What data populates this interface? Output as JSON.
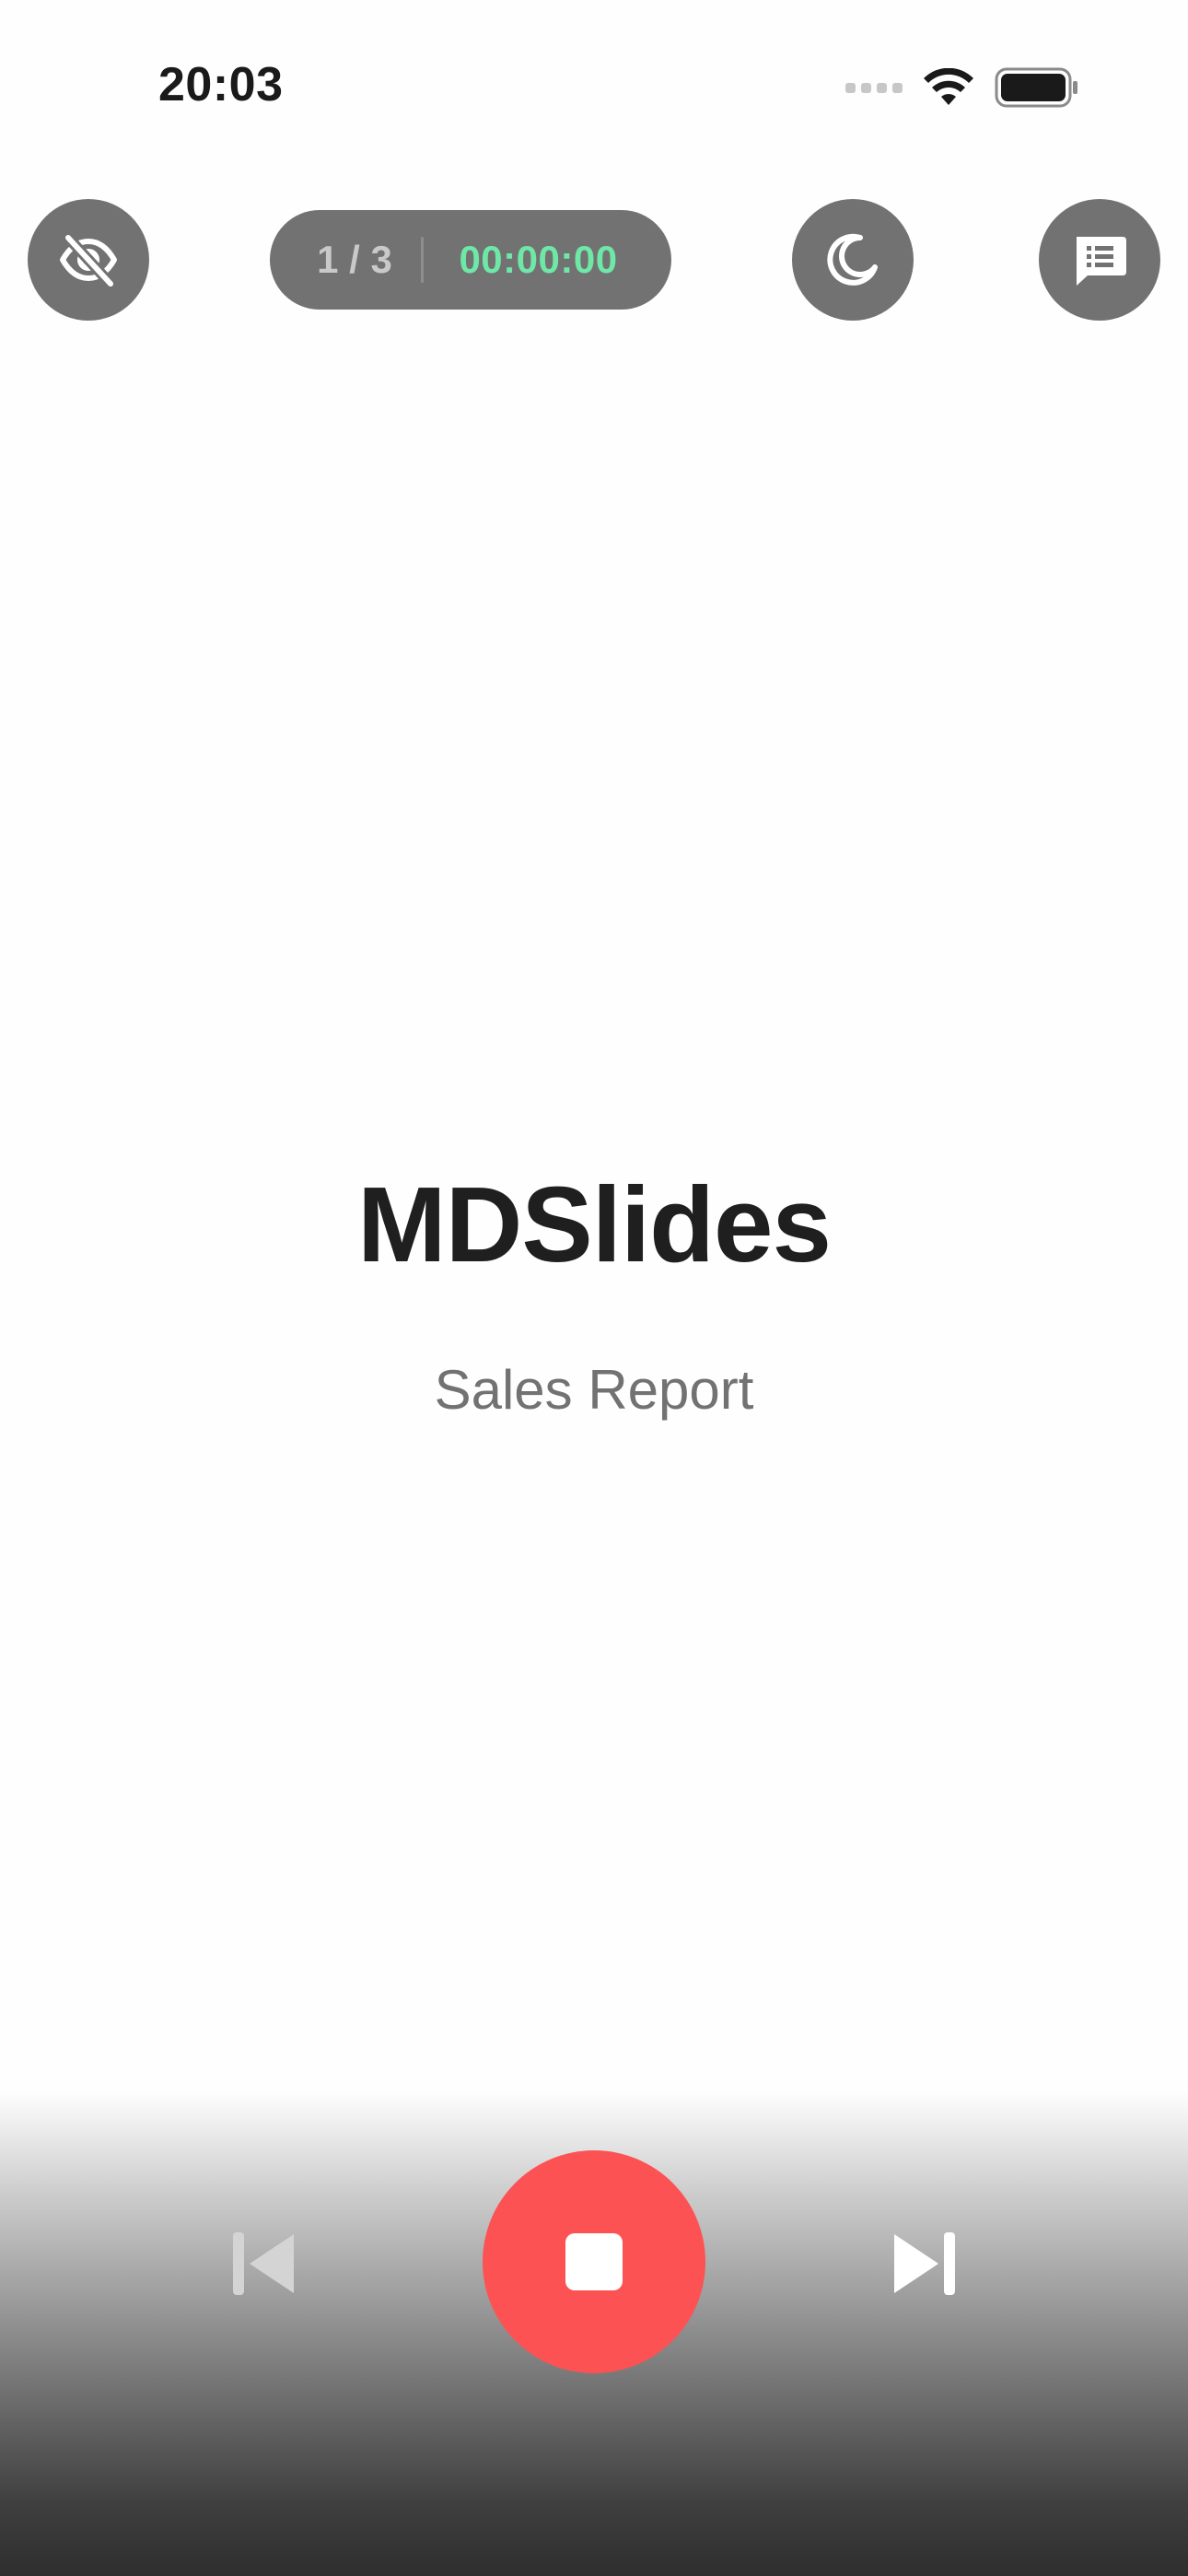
{
  "status_bar": {
    "time": "20:03"
  },
  "top_controls": {
    "hide_button_icon": "eye-slash-icon",
    "slide_counter": "1 / 3",
    "timer": "00:00:00",
    "theme_button_icon": "moon-icon",
    "notes_button_icon": "notes-bubble-icon"
  },
  "slide": {
    "title": "MDSlides",
    "subtitle": "Sales Report"
  },
  "bottom_controls": {
    "previous_icon": "skip-back-icon",
    "stop_icon": "stop-icon",
    "next_icon": "skip-forward-icon"
  },
  "colors": {
    "control_background": "#727272",
    "timer_text": "#6ee7a7",
    "stop_button": "#fc5254",
    "title_text": "#1f1f1f",
    "subtitle_text": "#727272"
  }
}
